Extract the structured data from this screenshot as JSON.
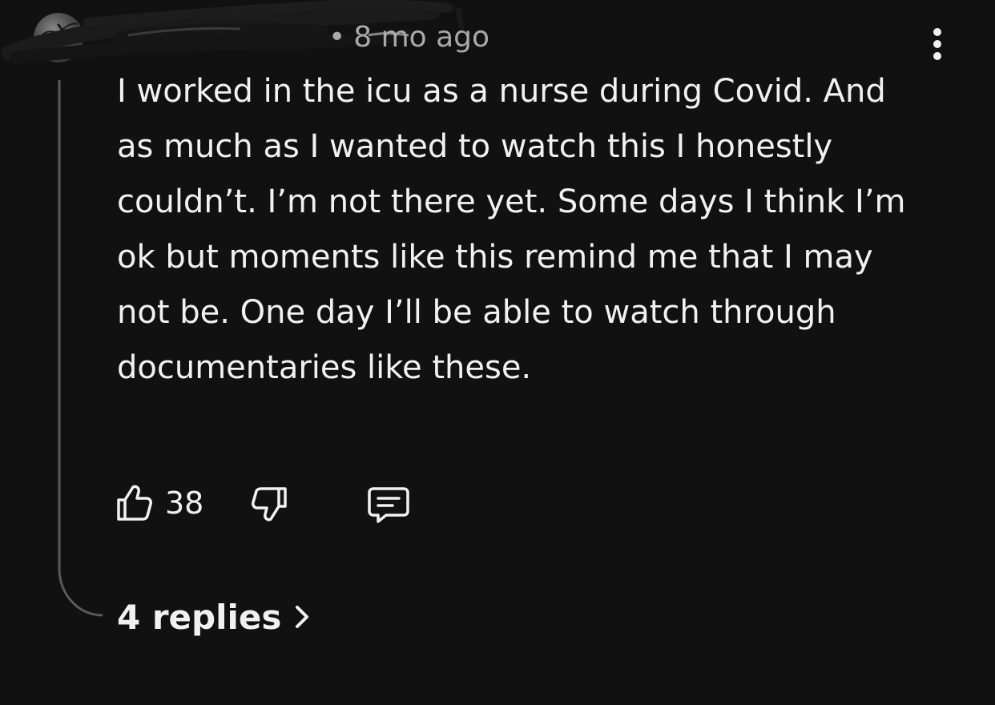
{
  "comment": {
    "time_ago": "8 mo ago",
    "separator": "•",
    "body": "I worked in the icu as a nurse during Covid. And as much as I wanted to watch this I honestly couldn’t. I’m not there yet. Some days I think I’m ok but moments like this remind me that I may not be. One day I’ll be able to watch through documentaries like these.",
    "like_count": "38",
    "replies_label": "4 replies"
  },
  "icons": {
    "avatar": "avatar-image",
    "more": "more-vert-icon",
    "like": "thumbs-up-icon",
    "dislike": "thumbs-down-icon",
    "reply": "comment-bubble-icon",
    "replies_arrow": "chevron-right-icon"
  },
  "colors": {
    "background": "#111111",
    "text_primary": "#f1f1f1",
    "text_secondary": "#a9a9a9",
    "thread_line": "#5a5a5a"
  }
}
